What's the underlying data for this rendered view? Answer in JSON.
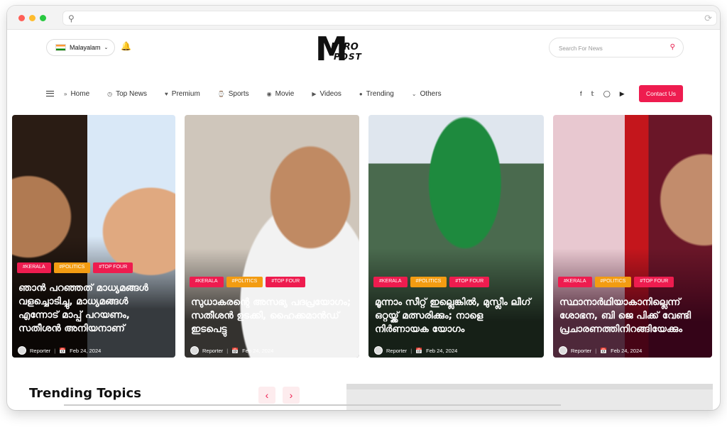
{
  "header": {
    "language": "Malayalam",
    "search_placeholder": "Search For News",
    "logo_line1": "M",
    "logo_line2": "ETRO",
    "logo_line3": "POST",
    "contact_label": "Contact Us"
  },
  "nav": {
    "items": [
      {
        "label": "Home",
        "icon": "double-chevron-right-icon"
      },
      {
        "label": "Top News",
        "icon": "clock-icon"
      },
      {
        "label": "Premium",
        "icon": "heart-icon"
      },
      {
        "label": "Sports",
        "icon": "sports-icon"
      },
      {
        "label": "Movie",
        "icon": "film-icon"
      },
      {
        "label": "Videos",
        "icon": "video-icon"
      },
      {
        "label": "Trending",
        "icon": "trending-icon"
      },
      {
        "label": "Others",
        "icon": "chevron-down-icon"
      }
    ]
  },
  "cards": [
    {
      "tags": [
        "#KERALA",
        "#POLITICS",
        "#TOP FOUR"
      ],
      "headline": "ഞാൻ പറഞ്ഞത് മാധ്യമങ്ങൾ വളച്ചൊടിച്ചു, മാധ്യമങ്ങൾ എന്നോട് മാപ്പ് പറയണം, സതീശൻ അനിയനാണ്",
      "author": "Reporter",
      "date": "Feb 24, 2024"
    },
    {
      "tags": [
        "#KERALA",
        "#POLITICS",
        "#TOP FOUR"
      ],
      "headline": "സുധാകരന്റെ അസഭ്യ പദപ്രയോഗം; സതീശൻ ഉടക്കി, ഹൈക്കമാൻഡ് ഇടപെട്ടു",
      "author": "Reporter",
      "date": "Feb 24, 2024"
    },
    {
      "tags": [
        "#KERALA",
        "#POLITICS",
        "#TOP FOUR"
      ],
      "headline": "മൂന്നാം സീറ്റ് ഇല്ലെങ്കിൽ, മുസ്ലീം ലീഗ് ഒറ്റയ്ക്ക് മത്സരിക്കും; നാളെ നിർണായക യോഗം",
      "author": "Reporter",
      "date": "Feb 24, 2024"
    },
    {
      "tags": [
        "#KERALA",
        "#POLITICS",
        "#TOP FOUR"
      ],
      "headline": "സ്ഥാനാർഥിയാകാനില്ലെന്ന് ശോഭന, ബി ജെ പിക്ക് വേണ്ടി പ്രചാരണത്തിനിറങ്ങിയേക്കും",
      "author": "Reporter",
      "date": "Feb 24, 2024"
    }
  ],
  "section": {
    "trending_title": "Trending Topics"
  },
  "colors": {
    "accent": "#ee1c4f",
    "tag_orange": "#f39c12"
  }
}
